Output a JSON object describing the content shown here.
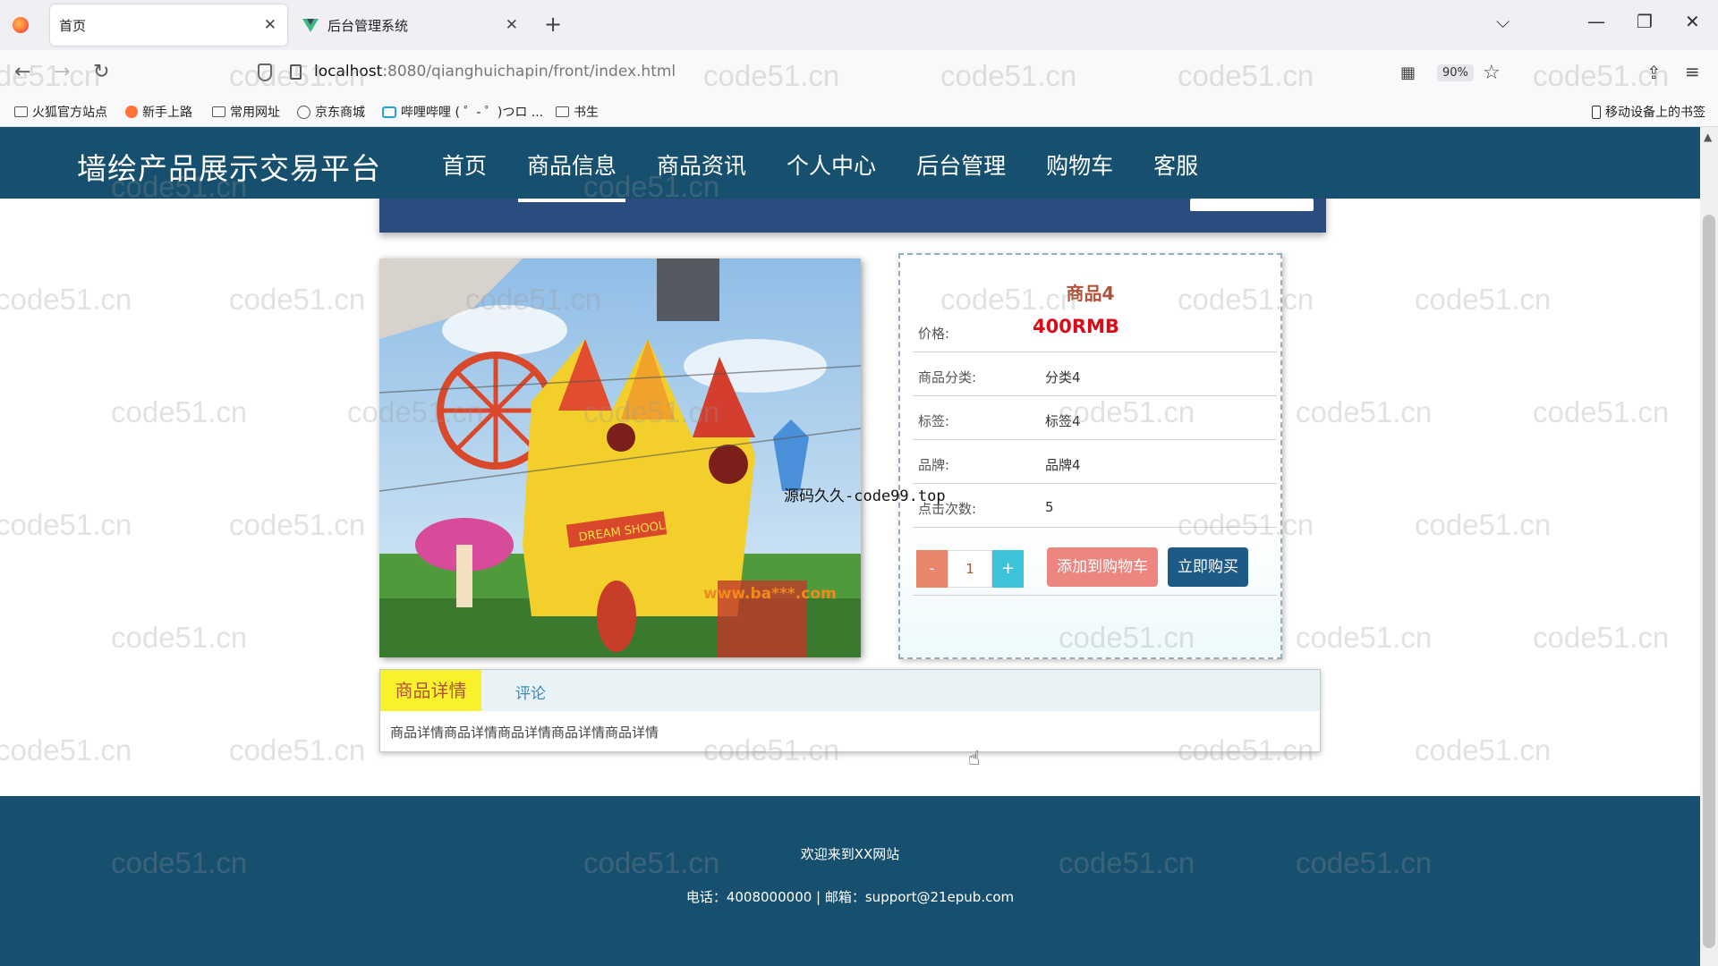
{
  "browser": {
    "tabs": [
      {
        "title": "首页",
        "active": true
      },
      {
        "title": "后台管理系统",
        "active": false
      }
    ],
    "url_host": "localhost",
    "url_path": ":8080/qianghuichapin/front/index.html",
    "zoom": "90%",
    "bookmarks": [
      "火狐官方站点",
      "新手上路",
      "常用网址",
      "京东商城",
      "哔哩哔哩 ( ゜- ゜)つロ ...",
      "书生"
    ],
    "mobile_bookmarks": "移动设备上的书签"
  },
  "site": {
    "title": "墙绘产品展示交易平台",
    "nav": [
      "首页",
      "商品信息",
      "商品资讯",
      "个人中心",
      "后台管理",
      "购物车",
      "客服"
    ],
    "active_nav": "商品信息"
  },
  "product": {
    "name": "商品4",
    "price_label": "价格:",
    "price": "400RMB",
    "category_label": "商品分类:",
    "category": "分类4",
    "tag_label": "标签:",
    "tag": "标签4",
    "brand_label": "品牌:",
    "brand": "品牌4",
    "clicks_label": "点击次数:",
    "clicks": "5",
    "quantity": "1",
    "minus": "-",
    "plus": "+",
    "add_to_cart": "添加到购物车",
    "buy_now": "立即购买",
    "image_text": "DREAM SHOOL",
    "image_watermark": "www.ba***.com"
  },
  "tabs": {
    "detail": "商品详情",
    "comments": "评论",
    "detail_content": "商品详情商品详情商品详情商品详情商品详情"
  },
  "footer": {
    "welcome": "欢迎来到XX网站",
    "contact": "电话：4008000000 | 邮箱：support@21epub.com"
  },
  "overlay": {
    "source_watermark": "源码久久-code99.top",
    "grid_watermark": "code51.cn"
  },
  "colors": {
    "header_bg": "#17506f",
    "price": "#d80c18",
    "cart_btn": "#ee8680",
    "buy_btn": "#1d5a86",
    "active_tab": "#f8f22c"
  }
}
